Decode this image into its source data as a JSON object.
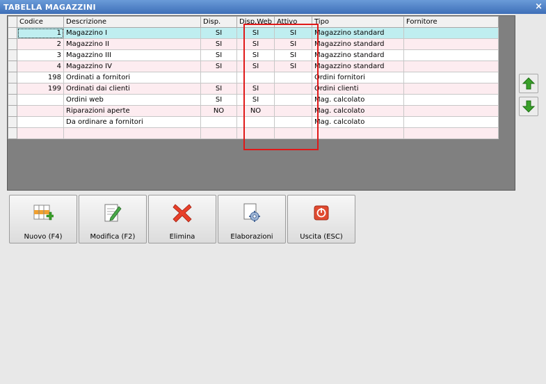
{
  "window": {
    "title": "TABELLA MAGAZZINI",
    "close_label": "×"
  },
  "grid": {
    "columns": [
      "Codice",
      "Descrizione",
      "Disp.",
      "Disp.Web",
      "Attivo",
      "Tipo",
      "Fornitore"
    ],
    "rows": [
      [
        "1",
        "Magazzino I",
        "SI",
        "SI",
        "SI",
        "Magazzino standard",
        ""
      ],
      [
        "2",
        "Magazzino II",
        "SI",
        "SI",
        "SI",
        "Magazzino standard",
        ""
      ],
      [
        "3",
        "Magazzino III",
        "SI",
        "SI",
        "SI",
        "Magazzino standard",
        ""
      ],
      [
        "4",
        "Magazzino IV",
        "SI",
        "SI",
        "SI",
        "Magazzino standard",
        ""
      ],
      [
        "198",
        "Ordinati a fornitori",
        "",
        "",
        "",
        "Ordini fornitori",
        ""
      ],
      [
        "199",
        "Ordinati dai clienti",
        "SI",
        "SI",
        "",
        "Ordini clienti",
        ""
      ],
      [
        "",
        "Ordini web",
        "SI",
        "SI",
        "",
        "Mag. calcolato",
        ""
      ],
      [
        "",
        "Riparazioni aperte",
        "NO",
        "NO",
        "",
        "Mag. calcolato",
        ""
      ],
      [
        "",
        "Da ordinare a fornitori",
        "",
        "",
        "",
        "Mag. calcolato",
        ""
      ],
      [
        "",
        "",
        "",
        "",
        "",
        "",
        ""
      ]
    ],
    "selected_row": 0
  },
  "arrows": {
    "up_icon": "arrow-up-icon",
    "down_icon": "arrow-down-icon",
    "color": "#3aa02a"
  },
  "toolbar": {
    "nuovo": "Nuovo (F4)",
    "modifica": "Modifica (F2)",
    "elimina": "Elimina",
    "elaborazioni": "Elaborazioni",
    "uscita": "Uscita (ESC)"
  },
  "colors": {
    "accent_red": "#e01818",
    "selected_row": "#bfeef0",
    "alt_row": "#fdecf0"
  }
}
